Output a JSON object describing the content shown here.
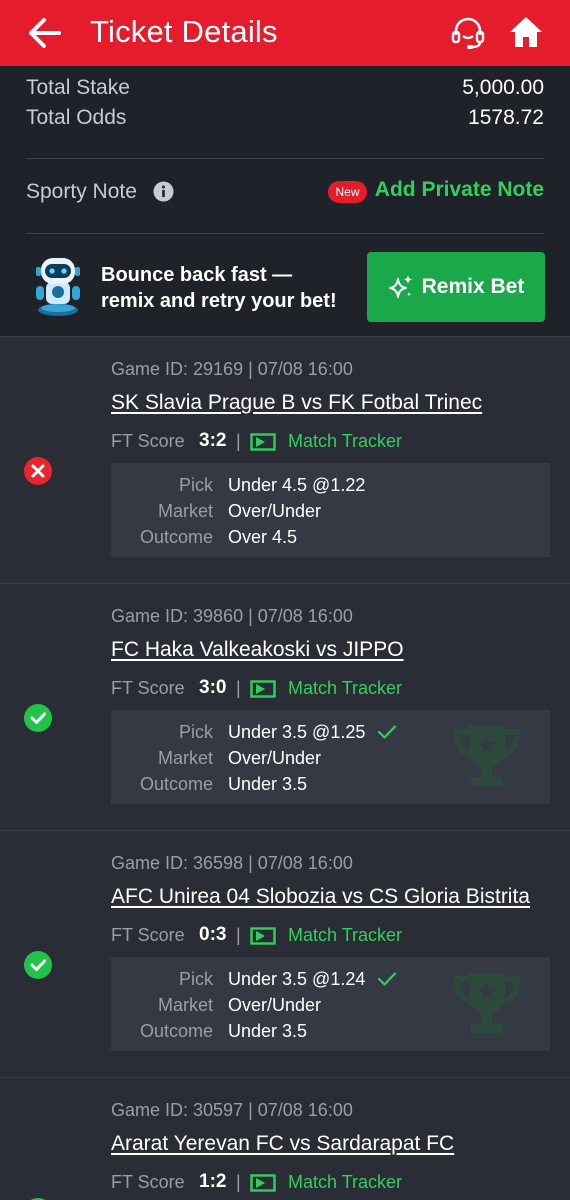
{
  "header": {
    "title": "Ticket Details",
    "color": "#e41c2b"
  },
  "summary": {
    "total_stake_label": "Total Stake",
    "total_stake_value": "5,000.00",
    "total_odds_label": "Total Odds",
    "total_odds_value": "1578.72",
    "note_label": "Sporty Note",
    "new_badge": "New",
    "add_note_label": "Add Private Note"
  },
  "promo": {
    "line1": "Bounce back fast —",
    "line2": "remix and retry your bet!",
    "button_label": "Remix Bet"
  },
  "labels": {
    "ft_score": "FT Score",
    "separator": "|",
    "match_tracker": "Match Tracker",
    "pick": "Pick",
    "market": "Market",
    "outcome": "Outcome"
  },
  "games": [
    {
      "game_id": "Game ID: 29169 | 07/08 16:00",
      "match": "SK Slavia Prague B vs FK Fotbal Trinec",
      "score": "3:2",
      "pick": "Under 4.5 @1.22",
      "market": "Over/Under",
      "outcome": "Over 4.5",
      "status": "lost"
    },
    {
      "game_id": "Game ID: 39860 | 07/08 16:00",
      "match": "FC Haka Valkeakoski vs JIPPO",
      "score": "3:0",
      "pick": "Under 3.5 @1.25",
      "market": "Over/Under",
      "outcome": "Under 3.5",
      "status": "won"
    },
    {
      "game_id": "Game ID: 36598 | 07/08 16:00",
      "match": "AFC Unirea 04 Slobozia vs CS Gloria Bistrita",
      "score": "0:3",
      "pick": "Under 3.5 @1.24",
      "market": "Over/Under",
      "outcome": "Under 3.5",
      "status": "won"
    },
    {
      "game_id": "Game ID: 30597 | 07/08 16:00",
      "match": "Ararat Yerevan FC vs Sardarapat FC",
      "score": "1:2",
      "status": "won"
    }
  ],
  "colors": {
    "brand_red": "#e41c2b",
    "accent_green": "#2fd15d",
    "button_green": "#1ba84a",
    "lost_red": "#e8262f",
    "won_green": "#23c24a"
  },
  "icons": {
    "back": "arrow-left-icon",
    "support": "headset-icon",
    "home": "home-icon",
    "info": "info-icon",
    "sparkle": "sparkle-icon",
    "tracker": "tracker-icon",
    "trophy": "trophy-icon"
  }
}
